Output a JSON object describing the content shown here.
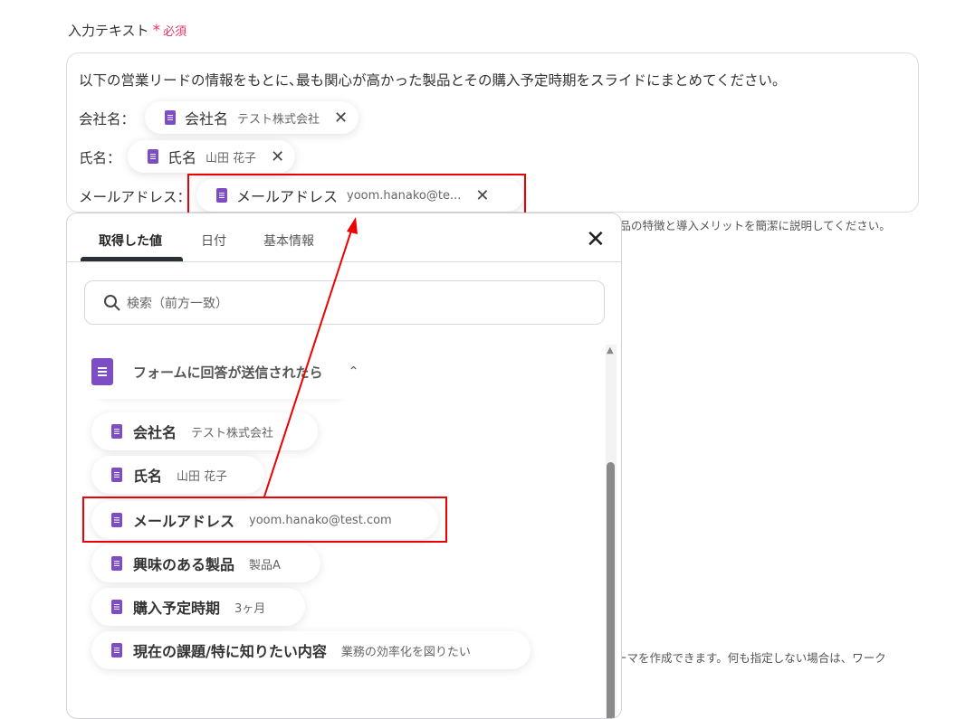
{
  "field": {
    "label": "入力テキスト",
    "required_mark": "*",
    "required_text": "必須"
  },
  "textarea": {
    "line1": "以下の営業リードの情報をもとに､最も関心が高かった製品とその購入予定時期をスライドにまとめてください。",
    "rows": [
      {
        "prefix": "会社名：",
        "chip_name": "会社名",
        "chip_value": "テスト株式会社"
      },
      {
        "prefix": "氏名：",
        "chip_name": "氏名",
        "chip_value": "山田 花子"
      },
      {
        "prefix": "メールアドレス：",
        "chip_name": "メールアドレス",
        "chip_value": "yoom.hanako@te..."
      }
    ]
  },
  "hints": {
    "upper": "製品の特徴と導入メリットを簡潔に説明してください。",
    "lower": "ーマを作成できます。何も指定しない場合は、ワーク"
  },
  "panel": {
    "tabs": [
      {
        "label": "取得した値",
        "active": true
      },
      {
        "label": "日付"
      },
      {
        "label": "基本情報"
      }
    ],
    "search_placeholder": "検索（前方一致）",
    "group_title": "フォームに回答が送信されたら",
    "items": [
      {
        "name": "会社名",
        "value": "テスト株式会社"
      },
      {
        "name": "氏名",
        "value": "山田 花子"
      },
      {
        "name": "メールアドレス",
        "value": "yoom.hanako@test.com"
      },
      {
        "name": "興味のある製品",
        "value": "製品A"
      },
      {
        "name": "購入予定時期",
        "value": "3ヶ月"
      },
      {
        "name": "現在の課題/特に知りたい内容",
        "value": "業務の効率化を図りたい"
      }
    ]
  },
  "colors": {
    "accent": "#7c4dc4",
    "required": "#e8335f",
    "highlight": "#ee0000"
  }
}
